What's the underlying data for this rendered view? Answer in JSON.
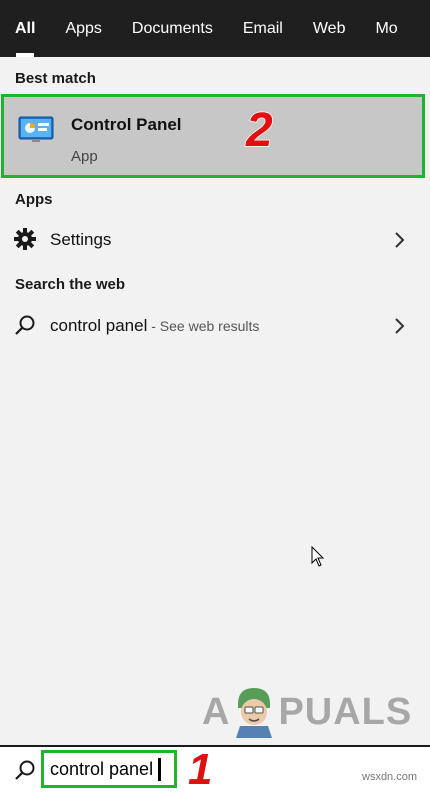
{
  "tabs": [
    {
      "label": "All",
      "active": true
    },
    {
      "label": "Apps"
    },
    {
      "label": "Documents"
    },
    {
      "label": "Email"
    },
    {
      "label": "Web"
    },
    {
      "label": "Mo"
    }
  ],
  "best_match": {
    "section_label": "Best match",
    "title": "Control Panel",
    "subtitle": "App",
    "icon": "control-panel-icon",
    "step_number": "2"
  },
  "apps": {
    "section_label": "Apps",
    "items": [
      {
        "label": "Settings",
        "icon": "gear-icon"
      }
    ]
  },
  "web": {
    "section_label": "Search the web",
    "items": [
      {
        "label": "control panel",
        "hint": " - See web results",
        "icon": "search-icon"
      }
    ]
  },
  "watermark": {
    "left": "A",
    "right": "PUALS"
  },
  "search": {
    "value": "control panel",
    "step_number": "1"
  },
  "credit": "wsxdn.com",
  "colors": {
    "tab_bar": "#1f1f1f",
    "panel": "#f2f2f2",
    "selected": "#c7c7c7",
    "highlight_border": "#1db52e",
    "step_red": "#e01010"
  }
}
